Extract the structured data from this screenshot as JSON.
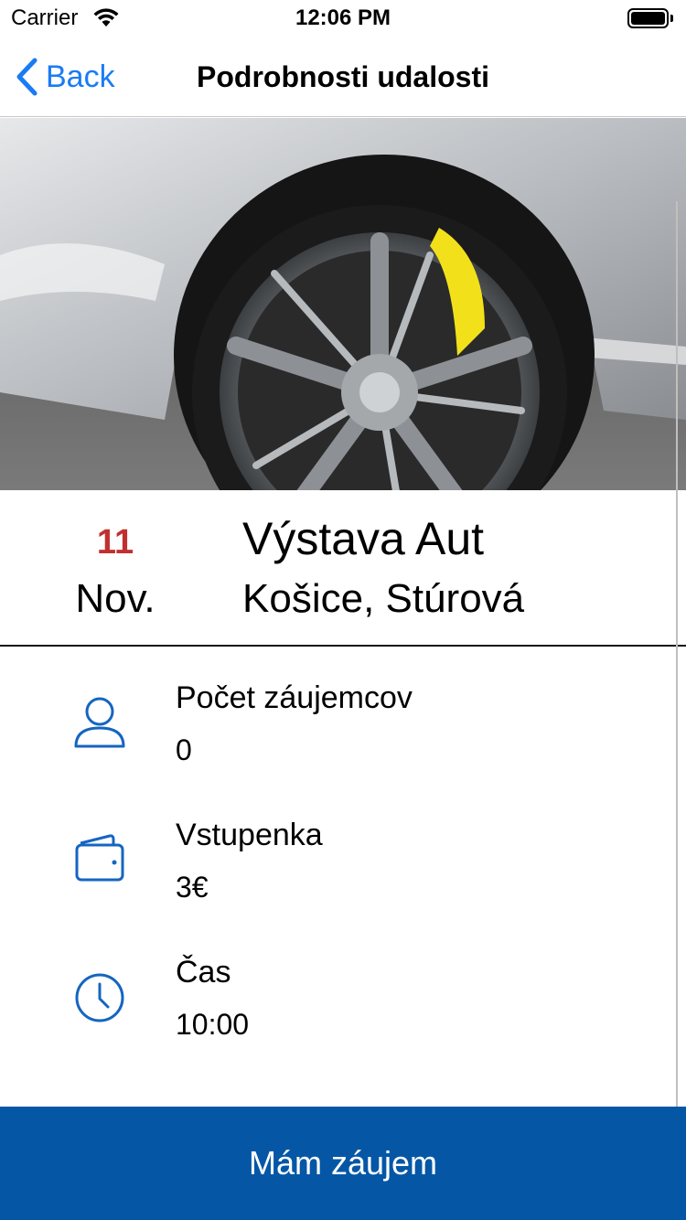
{
  "status_bar": {
    "carrier": "Carrier",
    "time": "12:06 PM"
  },
  "nav": {
    "back_label": "Back",
    "title": "Podrobnosti udalosti"
  },
  "event": {
    "day": "11",
    "month": "Nov.",
    "title": "Výstava Aut",
    "location": "Košice, Stúrová"
  },
  "details": [
    {
      "icon": "person-icon",
      "label": "Počet záujemcov",
      "value": "0"
    },
    {
      "icon": "wallet-icon",
      "label": "Vstupenka",
      "value": "3€"
    },
    {
      "icon": "clock-icon",
      "label": "Čas",
      "value": "10:00"
    }
  ],
  "cta": {
    "label": "Mám záujem"
  },
  "colors": {
    "accent": "#1a7cf5",
    "icon": "#1565c0",
    "date_red": "#c0302f",
    "cta_bg": "#0557a6"
  }
}
